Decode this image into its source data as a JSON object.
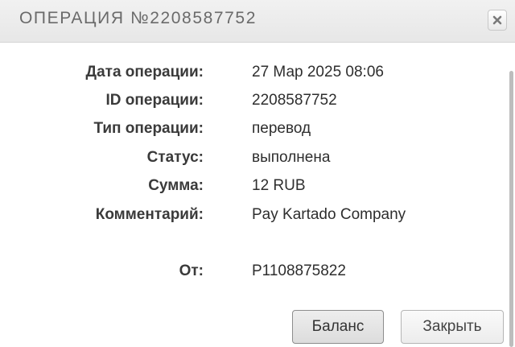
{
  "dialog": {
    "title": "ОПЕРАЦИЯ №2208587752",
    "close_icon": "close-x-icon"
  },
  "details": {
    "date_label": "Дата операции:",
    "date_value": "27 Мар 2025 08:06",
    "id_label": "ID операции:",
    "id_value": "2208587752",
    "type_label": "Тип операции:",
    "type_value": "перевод",
    "status_label": "Статус:",
    "status_value": "выполнена",
    "amount_label": "Сумма:",
    "amount_value": "12 RUB",
    "comment_label": "Комментарий:",
    "comment_value": "Pay Kartado Company",
    "from_label": "От:",
    "from_value": "P1108875822"
  },
  "buttons": {
    "balance_label": "Баланс",
    "close_label": "Закрыть"
  }
}
